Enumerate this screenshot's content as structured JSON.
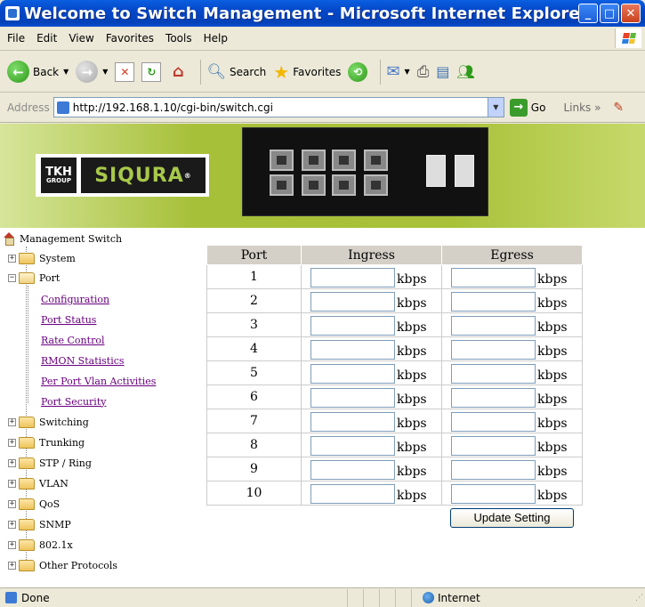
{
  "window": {
    "title": "Welcome to Switch Management - Microsoft Internet Explorer"
  },
  "menubar": {
    "items": [
      {
        "label": "File",
        "access": "F"
      },
      {
        "label": "Edit",
        "access": "E"
      },
      {
        "label": "View",
        "access": "V"
      },
      {
        "label": "Favorites",
        "access": "a"
      },
      {
        "label": "Tools",
        "access": "T"
      },
      {
        "label": "Help",
        "access": "H"
      }
    ]
  },
  "toolbar": {
    "back_label": "Back",
    "search_label": "Search",
    "favorites_label": "Favorites"
  },
  "address": {
    "label": "Address",
    "url": "http://192.168.1.10/cgi-bin/switch.cgi",
    "go_label": "Go",
    "links_label": "Links"
  },
  "banner": {
    "logo_tkh": "TKH",
    "logo_group": "GROUP",
    "logo_brand": "SIQURA",
    "logo_registered": "®"
  },
  "tree": {
    "root": "Management Switch",
    "nodes": [
      {
        "label": "System",
        "expanded": false
      },
      {
        "label": "Port",
        "expanded": true,
        "children": [
          "Configuration",
          "Port Status",
          "Rate Control",
          "RMON Statistics",
          "Per Port Vlan Activities",
          "Port Security"
        ]
      },
      {
        "label": "Switching",
        "expanded": false
      },
      {
        "label": "Trunking",
        "expanded": false
      },
      {
        "label": "STP / Ring",
        "expanded": false
      },
      {
        "label": "VLAN",
        "expanded": false
      },
      {
        "label": "QoS",
        "expanded": false
      },
      {
        "label": "SNMP",
        "expanded": false
      },
      {
        "label": "802.1x",
        "expanded": false
      },
      {
        "label": "Other Protocols",
        "expanded": false
      }
    ]
  },
  "rate_table": {
    "headers": {
      "port": "Port",
      "ingress": "Ingress",
      "egress": "Egress"
    },
    "unit": "kbps",
    "rows": [
      "1",
      "2",
      "3",
      "4",
      "5",
      "6",
      "7",
      "8",
      "9",
      "10"
    ],
    "update_button": "Update Setting"
  },
  "statusbar": {
    "status": "Done",
    "zone": "Internet"
  },
  "colors": {
    "titlebar": "#0447c8",
    "banner_green": "#a7c039",
    "link_visited": "#6a0080"
  }
}
